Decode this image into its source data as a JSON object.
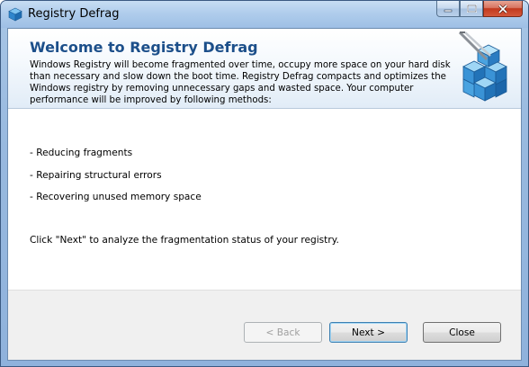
{
  "window": {
    "title": "Registry Defrag"
  },
  "header": {
    "title": "Welcome to Registry Defrag",
    "description": "Windows Registry will become fragmented over time, occupy more space on your hard disk than necessary and slow down the boot time. Registry Defrag compacts and optimizes the Windows registry by removing unnecessary gaps and wasted space. Your computer performance will be improved by following methods:"
  },
  "body": {
    "methods": [
      "- Reducing fragments",
      "- Repairing structural errors",
      "- Recovering unused memory space"
    ],
    "instruction": "Click \"Next\" to analyze the fragmentation status of your registry."
  },
  "footer": {
    "back_label": "< Back",
    "next_label": "Next >",
    "close_label": "Close"
  },
  "icons": {
    "app": "registry-cube-icon",
    "logo": "registry-cubes-tweezers-icon",
    "minimize": "minimize-icon",
    "maximize": "maximize-icon",
    "close": "close-icon"
  },
  "colors": {
    "title_accent": "#1c4f8a",
    "window_frame": "#98b9df",
    "close_button": "#c2391e"
  }
}
